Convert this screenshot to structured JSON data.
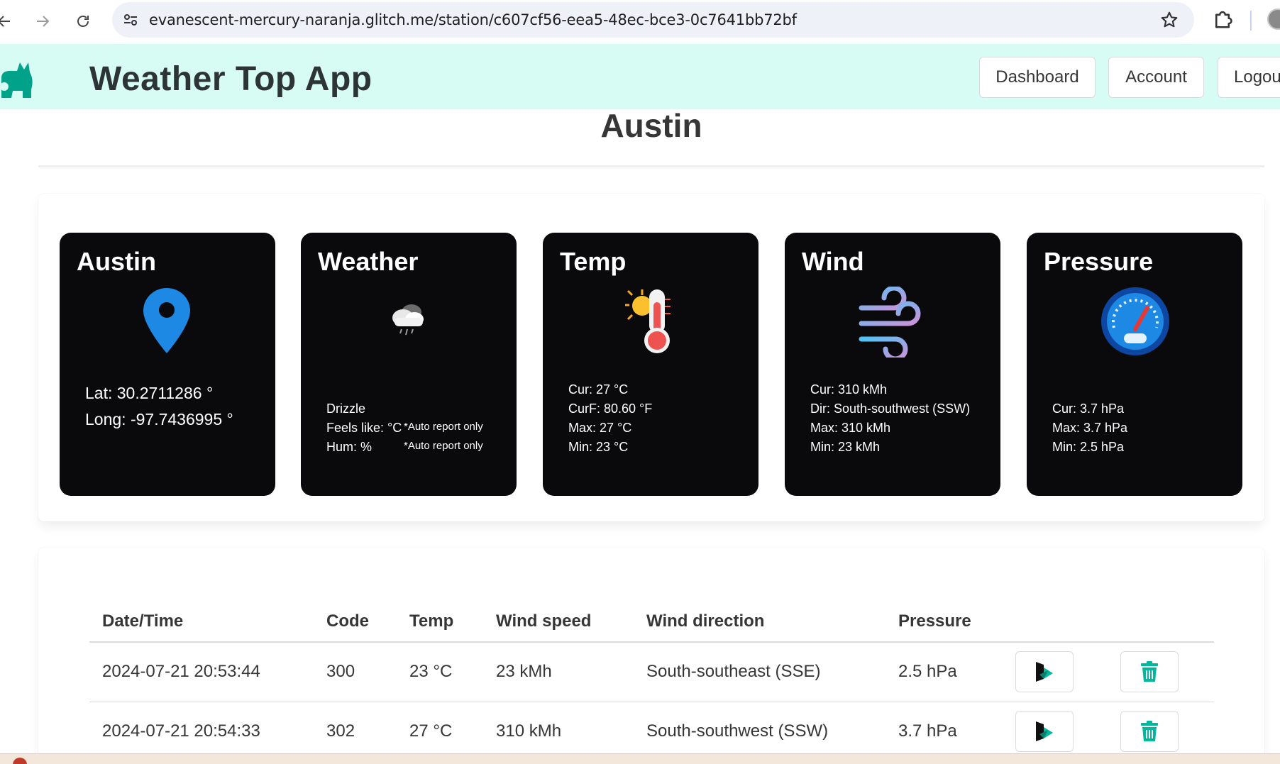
{
  "browser": {
    "url": "evanescent-mercury-naranja.glitch.me/station/c607cf56-eea5-48ec-bce3-0c7641bb72bf"
  },
  "navbar": {
    "title": "Weather Top App",
    "buttons": [
      "Dashboard",
      "Account",
      "Logou"
    ]
  },
  "page": {
    "title": "Austin"
  },
  "cards": {
    "location": {
      "title": "Austin",
      "lat": "Lat: 30.2711286 °",
      "long": "Long: -97.7436995 °",
      "icon": "map-pin-icon"
    },
    "weather": {
      "title": "Weather",
      "condition": "Drizzle",
      "feels_like": "Feels like: °C",
      "humidity": "Hum: %",
      "note1": "*Auto report only",
      "note2": "*Auto report only",
      "icon": "drizzle-cloud-icon"
    },
    "temp": {
      "title": "Temp",
      "cur": "Cur: 27 °C",
      "curf": "CurF: 80.60 °F",
      "max": "Max: 27 °C",
      "min": "Min: 23 °C",
      "icon": "thermometer-sun-icon"
    },
    "wind": {
      "title": "Wind",
      "cur": "Cur: 310 kMh",
      "dir": "Dir: South-southwest (SSW)",
      "max": "Max: 310 kMh",
      "min": "Min: 23 kMh",
      "icon": "wind-icon"
    },
    "pressure": {
      "title": "Pressure",
      "cur": "Cur: 3.7 hPa",
      "max": "Max: 3.7 hPa",
      "min": "Min: 2.5 hPa",
      "icon": "gauge-icon"
    }
  },
  "table": {
    "headers": [
      "Date/Time",
      "Code",
      "Temp",
      "Wind speed",
      "Wind direction",
      "Pressure"
    ],
    "rows": [
      [
        "2024-07-21 20:53:44",
        "300",
        "23 °C",
        "23 kMh",
        "South-southeast (SSE)",
        "2.5 hPa"
      ],
      [
        "2024-07-21 20:54:33",
        "302",
        "27 °C",
        "310 kMh",
        "South-southwest (SSW)",
        "3.7 hPa"
      ]
    ]
  },
  "colors": {
    "navbar_bg": "#d7fcf4",
    "card_bg": "#0a0a0c",
    "accent_teal": "#00b89c",
    "pin_blue": "#1e88e5"
  }
}
